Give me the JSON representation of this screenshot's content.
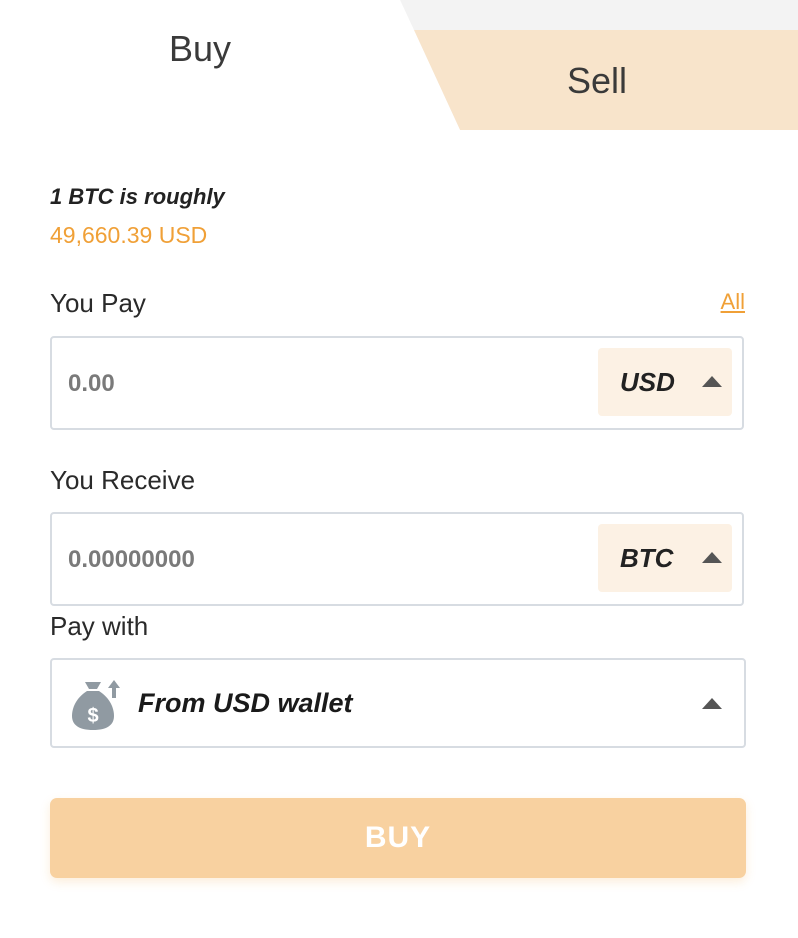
{
  "tabs": {
    "buy": "Buy",
    "sell": "Sell",
    "active": "buy"
  },
  "rate": {
    "label": "1 BTC is roughly",
    "value": "49,660.39 USD"
  },
  "pay": {
    "label": "You Pay",
    "all_link": "All",
    "placeholder": "0.00",
    "currency": "USD"
  },
  "receive": {
    "label": "You Receive",
    "placeholder": "0.00000000",
    "currency": "BTC"
  },
  "pay_with": {
    "label": "Pay with",
    "method": "From USD wallet",
    "icon": "money-bag-icon"
  },
  "action": {
    "buy_label": "BUY"
  },
  "colors": {
    "accent": "#f0a037",
    "sell_tab_bg": "#f8e4cb",
    "currency_bg": "#fcf1e4",
    "buy_button_bg": "#f8d1a0",
    "border": "#d7dce2"
  }
}
